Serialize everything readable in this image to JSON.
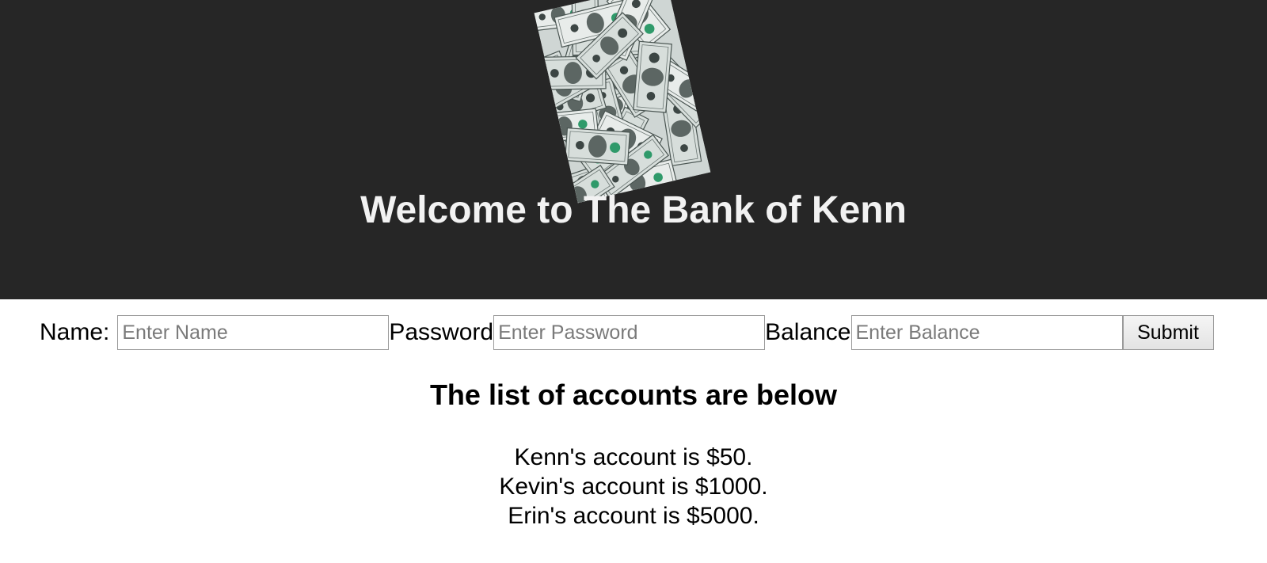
{
  "header": {
    "image": "money-pile-image",
    "title": "Welcome to The Bank of Kenn"
  },
  "form": {
    "name_label": "Name: ",
    "name_placeholder": "Enter Name",
    "password_label": "Password",
    "password_placeholder": "Enter Password",
    "balance_label": "Balance",
    "balance_placeholder": "Enter Balance",
    "submit_label": "Submit"
  },
  "accounts": {
    "heading": "The list of accounts are below",
    "items": [
      "Kenn's account is $50.",
      "Kevin's account is $1000.",
      "Erin's account is $5000."
    ]
  },
  "colors": {
    "header_bg": "#262626",
    "header_text": "#f2f2f2",
    "page_bg": "#ffffff"
  }
}
